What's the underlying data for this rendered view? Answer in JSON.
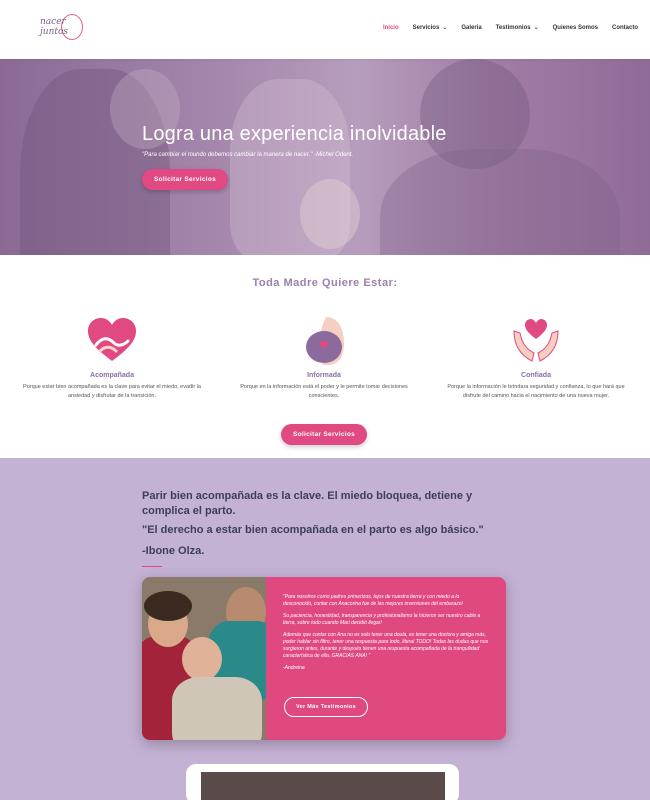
{
  "header": {
    "logo": {
      "line1": "nacer",
      "line2": "juntos"
    },
    "nav": [
      {
        "label": "Inicio",
        "active": true,
        "has_dropdown": false
      },
      {
        "label": "Servicios",
        "active": false,
        "has_dropdown": true
      },
      {
        "label": "Galeria",
        "active": false,
        "has_dropdown": false
      },
      {
        "label": "Testimonios",
        "active": false,
        "has_dropdown": true
      },
      {
        "label": "Quienes Somos",
        "active": false,
        "has_dropdown": false
      },
      {
        "label": "Contacto",
        "active": false,
        "has_dropdown": false
      }
    ]
  },
  "hero": {
    "title": "Logra una experiencia inolvidable",
    "quote": "\"Para cambiar el mundo debemos cambiar la manera de nacer.\" -Michel Odent.",
    "button": "Solicitar Servicios"
  },
  "features": {
    "heading": "Toda Madre Quiere Estar:",
    "items": [
      {
        "icon": "heart-hug-icon",
        "title": "Acompañada",
        "desc": "Porque estar bien acompañada es la clave para evitar el miedo, evadir la ansiedad y disfrutar de la transición."
      },
      {
        "icon": "pregnant-belly-icon",
        "title": "Informada",
        "desc": "Porque en la información está el poder y le permite tomar decisiones conscientes."
      },
      {
        "icon": "hands-heart-icon",
        "title": "Confiada",
        "desc": "Porque la información le brindara seguridad y confianza, lo que hará que disfrute del camino hacia el nacimiento de una nueva mujer."
      }
    ],
    "button": "Solicitar Servicios"
  },
  "testimonials": {
    "quote_line1": "Parir bien acompañada es la clave. El miedo bloquea, detiene y complica el parto.",
    "quote_line2": "\"El derecho a estar bien acompañada en el parto es algo básico.\"",
    "quote_author": "-Ibone Olza.",
    "card": {
      "paragraphs": [
        "\"Para nosotros como padres primerizos, lejos de nuestra tierra y con miedo a lo desconocido, contar con Anacorina fue de las mejores inversiones del embarazo!",
        "Su paciencia, honestidad, transparencia y profesionalismo la hicieron ser nuestro cable a tierra, sobre todo cuando Mari decidió llegar!",
        "Además que contar con Ana no es solo tener una doula, es tener una doctora y amiga más, poder hablar sin filtro, tener una respuesta para todo, literal TODO! Todas las dudas que nos surgieron antes, durante y después tienen una respuesta acompañada de la tranquilidad característica de ella. GRACIAS ANA! \"",
        "-Andreina"
      ],
      "button": "Ver Más Testimonios"
    }
  },
  "colors": {
    "accent": "#e04982",
    "purple_text": "#9c80a9",
    "testimonial_bg": "#c4b2d4",
    "heading_dark": "#3c3f55"
  }
}
